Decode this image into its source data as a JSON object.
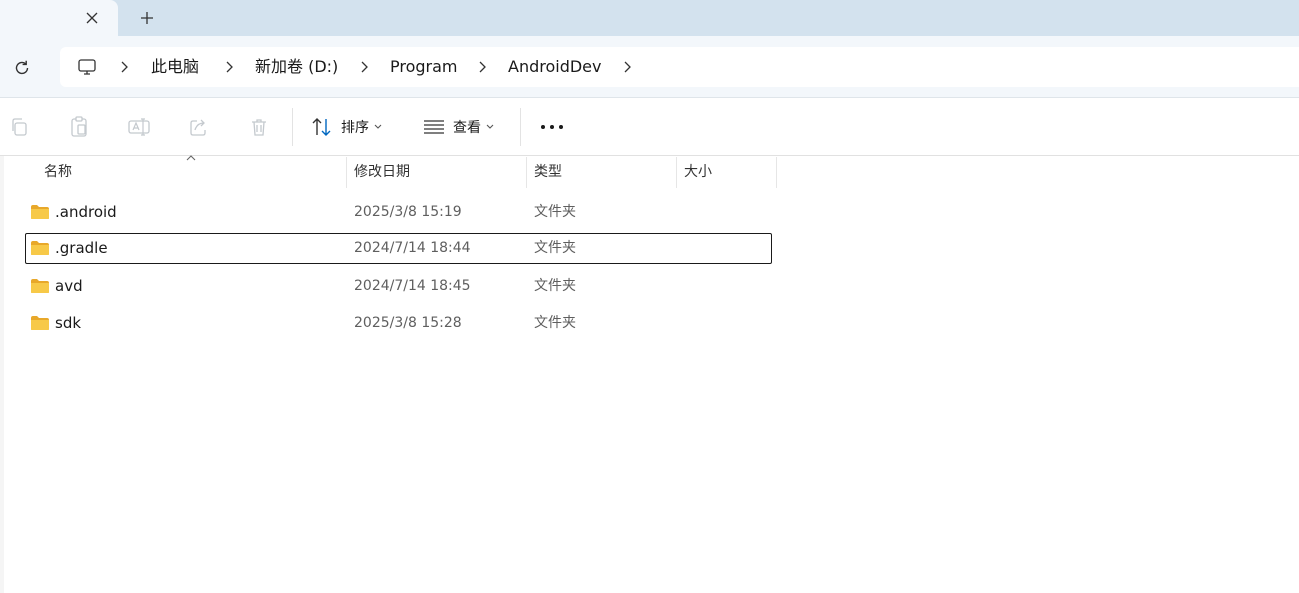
{
  "tabs": {
    "close_symbol": "✕",
    "new_symbol": "+"
  },
  "breadcrumb": {
    "items": [
      "此电脑",
      "新加卷 (D:)",
      "Program",
      "AndroidDev"
    ]
  },
  "toolbar": {
    "sort_label": "排序",
    "view_label": "查看",
    "more_label": "•••"
  },
  "columns": {
    "name": "名称",
    "modified": "修改日期",
    "type": "类型",
    "size": "大小"
  },
  "files": [
    {
      "name": ".android",
      "modified": "2025/3/8 15:19",
      "type": "文件夹",
      "size": ""
    },
    {
      "name": ".gradle",
      "modified": "2024/7/14 18:44",
      "type": "文件夹",
      "size": ""
    },
    {
      "name": "avd",
      "modified": "2024/7/14 18:45",
      "type": "文件夹",
      "size": ""
    },
    {
      "name": "sdk",
      "modified": "2025/3/8 15:28",
      "type": "文件夹",
      "size": ""
    }
  ],
  "selected_index": 1,
  "colors": {
    "tabstrip": "#d3e2ee",
    "folder": "#f7c948",
    "accent": "#0067c0"
  }
}
